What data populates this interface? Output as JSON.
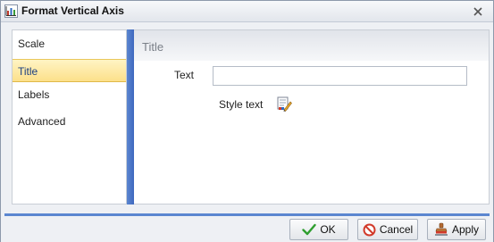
{
  "window": {
    "title": "Format Vertical Axis",
    "title_icon": "chart-axis-icon",
    "close_icon": "close-icon"
  },
  "nav": {
    "items": [
      {
        "label": "Scale",
        "selected": false
      },
      {
        "label": "Title",
        "selected": true
      },
      {
        "label": "Labels",
        "selected": false
      },
      {
        "label": "Advanced",
        "selected": false
      }
    ]
  },
  "panel": {
    "title": "Title",
    "text_label": "Text",
    "text_value": "",
    "style_label": "Style text",
    "style_icon": "style-text-icon"
  },
  "buttons": {
    "ok": "OK",
    "cancel": "Cancel",
    "apply": "Apply"
  },
  "colors": {
    "accent_blue": "#4f7bcb",
    "selected_bg": "#fce08a",
    "ok_check": "#2f9e2f",
    "cancel_red": "#d23a2a"
  }
}
